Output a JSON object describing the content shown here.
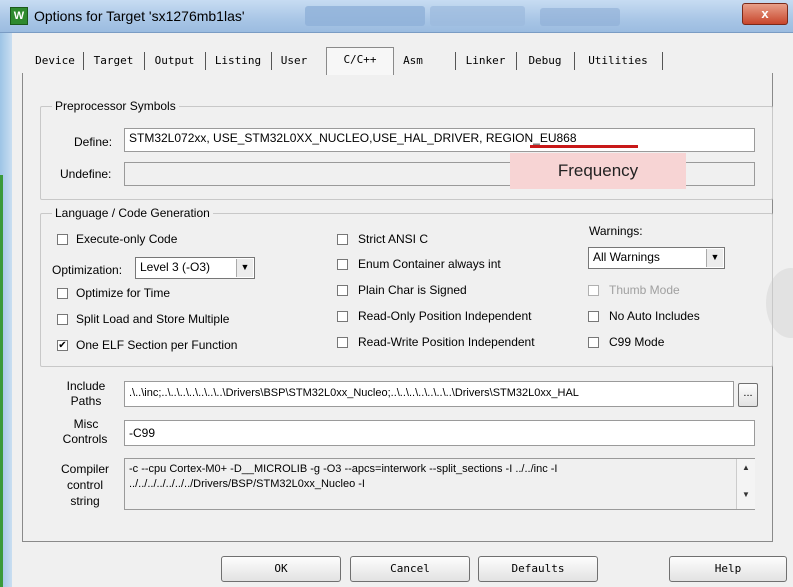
{
  "window": {
    "title": "Options for Target 'sx1276mb1las'",
    "close": "x",
    "app_icon_glyph": "W"
  },
  "tabs": [
    {
      "label": "Device"
    },
    {
      "label": "Target"
    },
    {
      "label": "Output"
    },
    {
      "label": "Listing"
    },
    {
      "label": "User"
    },
    {
      "label": "C/C++"
    },
    {
      "label": "Asm"
    },
    {
      "label": "Linker"
    },
    {
      "label": "Debug"
    },
    {
      "label": "Utilities"
    }
  ],
  "active_tab": "C/C++",
  "preprocessor": {
    "group_label": "Preprocessor Symbols",
    "define_label": "Define:",
    "define_value": "STM32L072xx, USE_STM32L0XX_NUCLEO,USE_HAL_DRIVER, REGION_EU868",
    "undefine_label": "Undefine:",
    "undefine_value": ""
  },
  "annotation": {
    "text": "Frequency",
    "underline_color": "#c81818",
    "box_color": "#f7d4d4"
  },
  "language": {
    "group_label": "Language / Code Generation",
    "execute_only": {
      "label": "Execute-only Code",
      "checked": false
    },
    "optimization_label": "Optimization:",
    "optimization_value": "Level 3 (-O3)",
    "optimize_time": {
      "label": "Optimize for Time",
      "checked": false
    },
    "split_load": {
      "label": "Split Load and Store Multiple",
      "checked": false
    },
    "one_elf": {
      "label": "One ELF Section per Function",
      "checked": true
    },
    "strict_ansi": {
      "label": "Strict ANSI C",
      "checked": false
    },
    "enum_container": {
      "label": "Enum Container always int",
      "checked": false
    },
    "plain_char": {
      "label": "Plain Char is Signed",
      "checked": false
    },
    "ro_pos": {
      "label": "Read-Only Position Independent",
      "checked": false
    },
    "rw_pos": {
      "label": "Read-Write Position Independent",
      "checked": false
    },
    "warnings_label": "Warnings:",
    "warnings_value": "All Warnings",
    "thumb_mode": {
      "label": "Thumb Mode",
      "checked": false,
      "disabled": true
    },
    "no_auto_includes": {
      "label": "No Auto Includes",
      "checked": false
    },
    "c99_mode": {
      "label": "C99 Mode",
      "checked": false
    }
  },
  "include": {
    "label_line1": "Include",
    "label_line2": "Paths",
    "value": ".\\..\\inc;..\\..\\..\\..\\..\\..\\..\\Drivers\\BSP\\STM32L0xx_Nucleo;..\\..\\..\\..\\..\\..\\..\\Drivers\\STM32L0xx_HAL",
    "browse": "..."
  },
  "misc": {
    "label_line1": "Misc",
    "label_line2": "Controls",
    "value": "-C99"
  },
  "compiler": {
    "label_line1": "Compiler",
    "label_line2": "control",
    "label_line3": "string",
    "line1": "-c --cpu Cortex-M0+ -D__MICROLIB -g -O3 --apcs=interwork --split_sections -I ../../inc -I",
    "line2": "../../../../../../../Drivers/BSP/STM32L0xx_Nucleo -I",
    "scroll_up": "▲",
    "scroll_down": "▼"
  },
  "buttons": {
    "ok": "OK",
    "cancel": "Cancel",
    "defaults": "Defaults",
    "help": "Help"
  },
  "icons": {
    "checkmark": "✔",
    "dropdown": "▼"
  }
}
